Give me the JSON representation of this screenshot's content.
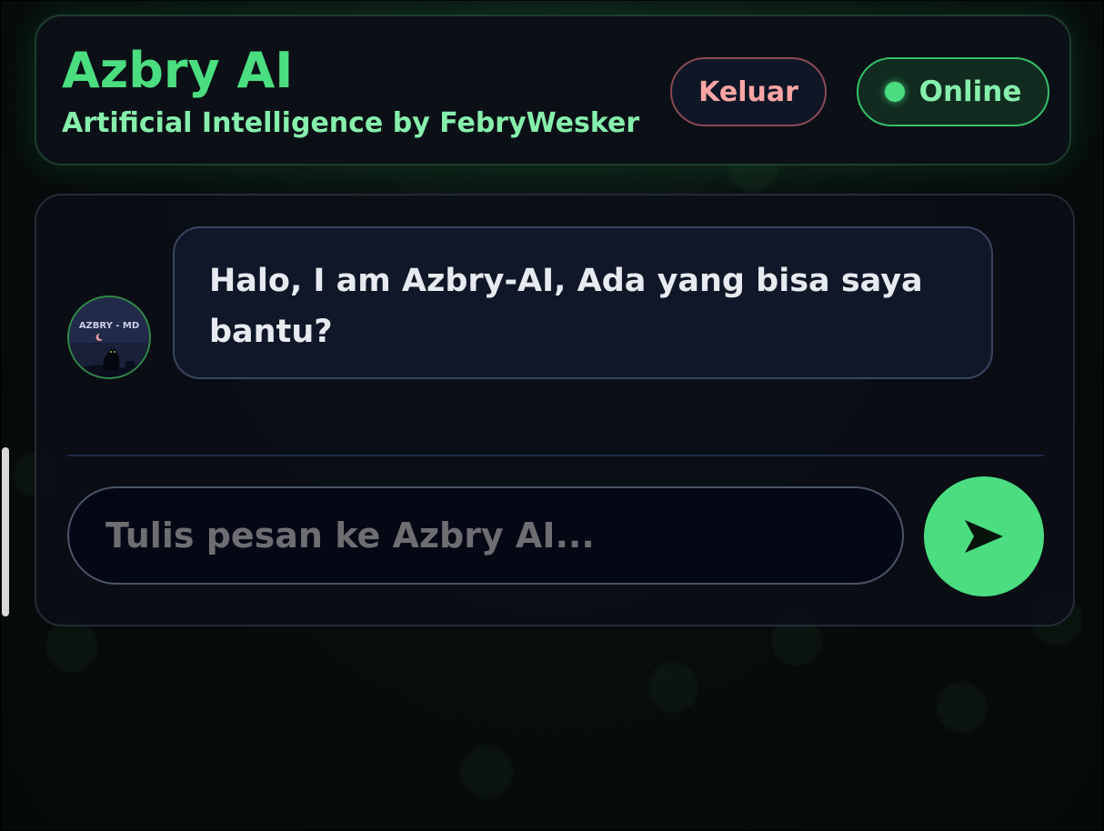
{
  "header": {
    "title": "Azbry AI",
    "subtitle": "Artificial Intelligence by FebryWesker",
    "logout_label": "Keluar",
    "status_label": "Online"
  },
  "chat": {
    "messages": [
      {
        "sender": "bot",
        "text": "Halo, I am Azbry-AI, Ada yang bisa saya bantu?",
        "avatar_text": "AZBRY - MD"
      }
    ]
  },
  "composer": {
    "placeholder": "Tulis pesan ke Azbry AI...",
    "value": "",
    "send_icon": "send-arrow-icon"
  },
  "colors": {
    "accent": "#4ade80",
    "accent_light": "#86efac",
    "danger": "#fca5a5",
    "panel_bg": "#0b1016"
  }
}
